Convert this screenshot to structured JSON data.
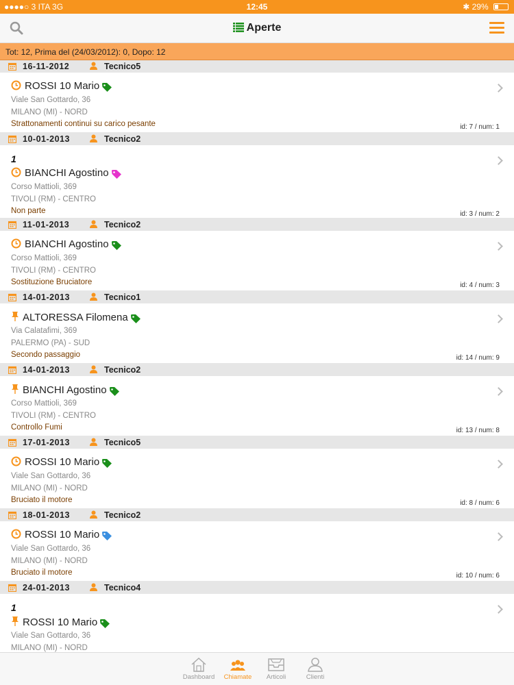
{
  "status_bar": {
    "carrier": "●●●●○ 3 ITA  3G",
    "time": "12:45",
    "battery": "29%"
  },
  "nav": {
    "title": "Aperte",
    "search_icon": "search-icon",
    "menu_icon": "menu-icon"
  },
  "summary": "Tot: 12, Prima del (24/03/2012): 0, Dopo: 12",
  "colors": {
    "accent": "#f7941d",
    "tag_green": "#1a8f1a",
    "tag_magenta": "#e633cc",
    "tag_blue": "#3a8fe0"
  },
  "groups": [
    {
      "date": "16-11-2012",
      "tech": "Tecnico5"
    },
    {
      "date": "10-01-2013",
      "tech": "Tecnico2"
    },
    {
      "date": "11-01-2013",
      "tech": "Tecnico2"
    },
    {
      "date": "14-01-2013",
      "tech": "Tecnico1"
    },
    {
      "date": "14-01-2013",
      "tech": "Tecnico2"
    },
    {
      "date": "17-01-2013",
      "tech": "Tecnico5"
    },
    {
      "date": "18-01-2013",
      "tech": "Tecnico2"
    },
    {
      "date": "24-01-2013",
      "tech": "Tecnico4"
    }
  ],
  "items": [
    {
      "number": "",
      "icon": "clock-icon",
      "name": "ROSSI 10 Mario",
      "tag": "green",
      "street": "Viale San Gottardo, 36",
      "city": "MILANO (MI) - NORD",
      "desc": "Strattonamenti continui su carico pesante",
      "ids": "id: 7 / num: 1"
    },
    {
      "number": "1",
      "icon": "clock-icon",
      "name": "BIANCHI Agostino",
      "tag": "magenta",
      "street": "Corso Mattioli, 369",
      "city": "TIVOLI (RM) - CENTRO",
      "desc": "Non parte",
      "ids": "id: 3 / num: 2"
    },
    {
      "number": "",
      "icon": "clock-icon",
      "name": "BIANCHI Agostino",
      "tag": "green",
      "street": "Corso Mattioli, 369",
      "city": "TIVOLI (RM) - CENTRO",
      "desc": "Sostituzione Bruciatore",
      "ids": "id: 4 / num: 3"
    },
    {
      "number": "",
      "icon": "pin-icon",
      "name": "ALTORESSA Filomena",
      "tag": "green",
      "street": "Via Calatafimi, 369",
      "city": "PALERMO (PA) - SUD",
      "desc": "Secondo passaggio",
      "ids": "id: 14 / num: 9"
    },
    {
      "number": "",
      "icon": "pin-icon",
      "name": "BIANCHI Agostino",
      "tag": "green",
      "street": "Corso Mattioli, 369",
      "city": "TIVOLI (RM) - CENTRO",
      "desc": "Controllo Fumi",
      "ids": "id: 13 / num: 8"
    },
    {
      "number": "",
      "icon": "clock-icon",
      "name": "ROSSI 10 Mario",
      "tag": "green",
      "street": "Viale San Gottardo, 36",
      "city": "MILANO (MI) - NORD",
      "desc": "Bruciato il motore",
      "ids": "id: 8 / num: 6"
    },
    {
      "number": "",
      "icon": "clock-icon",
      "name": "ROSSI 10 Mario",
      "tag": "blue",
      "street": "Viale San Gottardo, 36",
      "city": "MILANO (MI) - NORD",
      "desc": "Bruciato il motore",
      "ids": "id: 10 / num: 6"
    },
    {
      "number": "1",
      "icon": "pin-icon",
      "name": "ROSSI 10 Mario",
      "tag": "green",
      "street": "Viale San Gottardo, 36",
      "city": "MILANO (MI) - NORD",
      "desc": "",
      "ids": ""
    }
  ],
  "tabs": [
    {
      "label": "Dashboard",
      "icon": "home-icon",
      "active": false
    },
    {
      "label": "Chiamate",
      "icon": "people-icon",
      "active": true
    },
    {
      "label": "Articoli",
      "icon": "tray-icon",
      "active": false
    },
    {
      "label": "Clienti",
      "icon": "person-icon",
      "active": false
    }
  ]
}
